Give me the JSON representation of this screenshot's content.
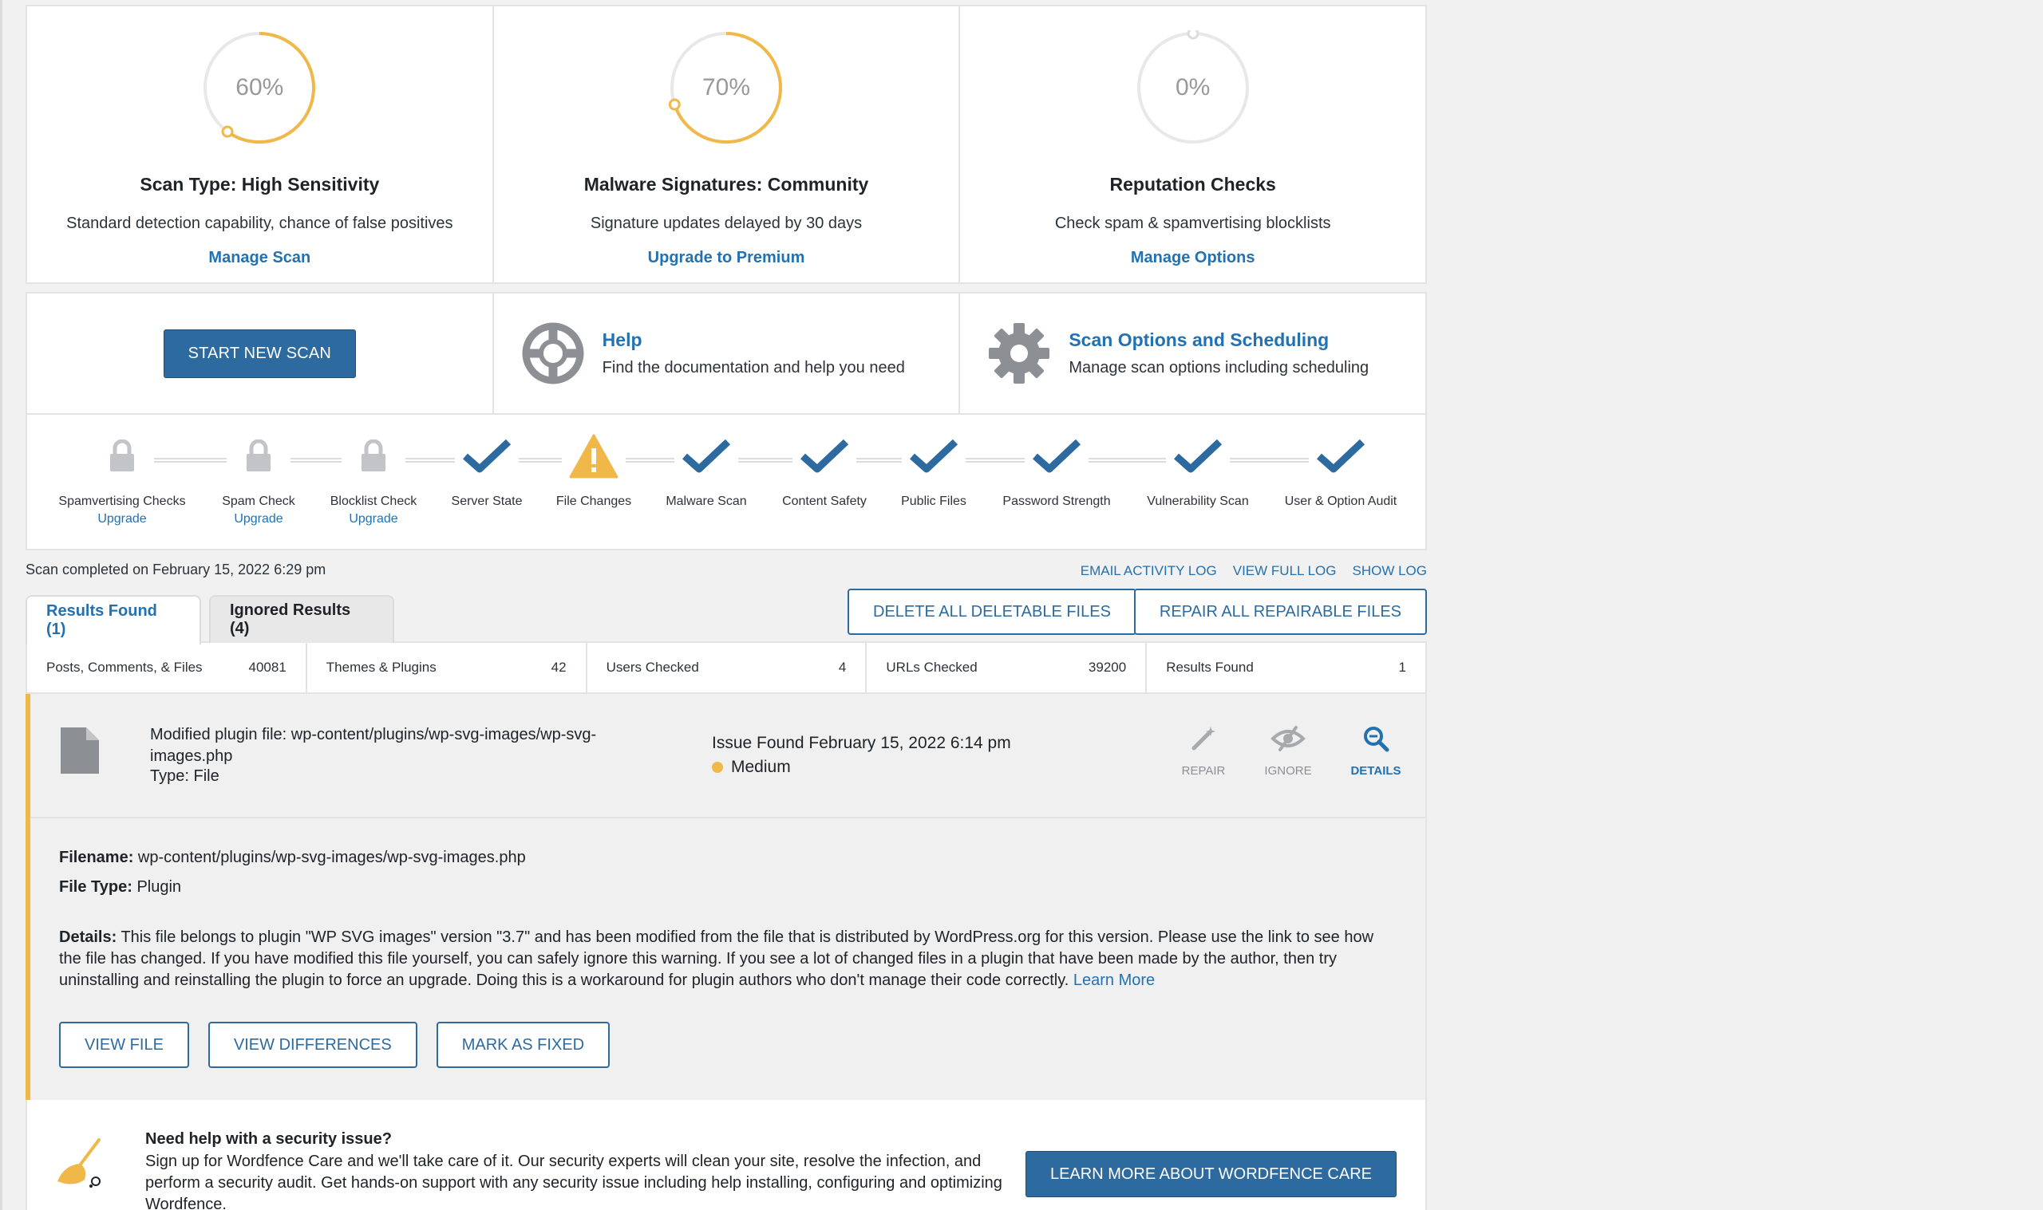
{
  "cards": [
    {
      "percent": "60%",
      "progress": 0.6,
      "title": "Scan Type: High Sensitivity",
      "desc": "Standard detection capability, chance of false positives",
      "link": "Manage Scan"
    },
    {
      "percent": "70%",
      "progress": 0.7,
      "title": "Malware Signatures: Community",
      "desc": "Signature updates delayed by 30 days",
      "link": "Upgrade to Premium"
    },
    {
      "percent": "0%",
      "progress": 0.0,
      "title": "Reputation Checks",
      "desc": "Check spam & spamvertising blocklists",
      "link": "Manage Options"
    }
  ],
  "actions": {
    "start_scan": "START NEW SCAN",
    "help_title": "Help",
    "help_desc": "Find the documentation and help you need",
    "options_title": "Scan Options and Scheduling",
    "options_desc": "Manage scan options including scheduling"
  },
  "stages": [
    {
      "label": "Spamvertising Checks",
      "status": "locked",
      "upgrade": "Upgrade"
    },
    {
      "label": "Spam Check",
      "status": "locked",
      "upgrade": "Upgrade"
    },
    {
      "label": "Blocklist Check",
      "status": "locked",
      "upgrade": "Upgrade"
    },
    {
      "label": "Server State",
      "status": "done"
    },
    {
      "label": "File Changes",
      "status": "warning"
    },
    {
      "label": "Malware Scan",
      "status": "done"
    },
    {
      "label": "Content Safety",
      "status": "done"
    },
    {
      "label": "Public Files",
      "status": "done"
    },
    {
      "label": "Password Strength",
      "status": "done"
    },
    {
      "label": "Vulnerability Scan",
      "status": "done"
    },
    {
      "label": "User & Option Audit",
      "status": "done"
    }
  ],
  "status": {
    "completed": "Scan completed on February 15, 2022 6:29 pm",
    "email_log": "EMAIL ACTIVITY LOG",
    "view_log": "VIEW FULL LOG",
    "show_log": "SHOW LOG"
  },
  "tabs": {
    "results": "Results Found (1)",
    "ignored": "Ignored Results (4)",
    "delete_all": "DELETE ALL DELETABLE FILES",
    "repair_all": "REPAIR ALL REPAIRABLE FILES"
  },
  "stats": [
    {
      "label": "Posts, Comments, & Files",
      "value": "40081"
    },
    {
      "label": "Themes & Plugins",
      "value": "42"
    },
    {
      "label": "Users Checked",
      "value": "4"
    },
    {
      "label": "URLs Checked",
      "value": "39200"
    },
    {
      "label": "Results Found",
      "value": "1"
    }
  ],
  "issue": {
    "title": "Modified plugin file: wp-content/plugins/wp-svg-images/wp-svg-images.php",
    "type": "Type: File",
    "found": "Issue Found February 15, 2022 6:14 pm",
    "severity": "Medium",
    "repair": "REPAIR",
    "ignore": "IGNORE",
    "details": "DETAILS",
    "filename_label": "Filename:",
    "filename": "wp-content/plugins/wp-svg-images/wp-svg-images.php",
    "filetype_label": "File Type:",
    "filetype": "Plugin",
    "details_label": "Details:",
    "details_text": "This file belongs to plugin \"WP SVG images\" version \"3.7\" and has been modified from the file that is distributed by WordPress.org for this version. Please use the link to see how the file has changed. If you have modified this file yourself, you can safely ignore this warning. If you see a lot of changed files in a plugin that have been made by the author, then try uninstalling and reinstalling the plugin to force an upgrade. Doing this is a workaround for plugin authors who don't manage their code correctly.",
    "learn_more": "Learn More",
    "view_file": "VIEW FILE",
    "view_diff": "VIEW DIFFERENCES",
    "mark_fixed": "MARK AS FIXED"
  },
  "care": {
    "title": "Need help with a security issue?",
    "text": "Sign up for Wordfence Care and we'll take care of it. Our security experts will clean your site, resolve the infection, and perform a security audit. Get hands-on support with any security issue including help installing, configuring and optimizing Wordfence.",
    "button": "LEARN MORE ABOUT WORDFENCE CARE"
  },
  "colors": {
    "accent": "#2271b1",
    "button": "#2c6aa0",
    "warning": "#f0b849",
    "check": "#2c6aa0"
  }
}
